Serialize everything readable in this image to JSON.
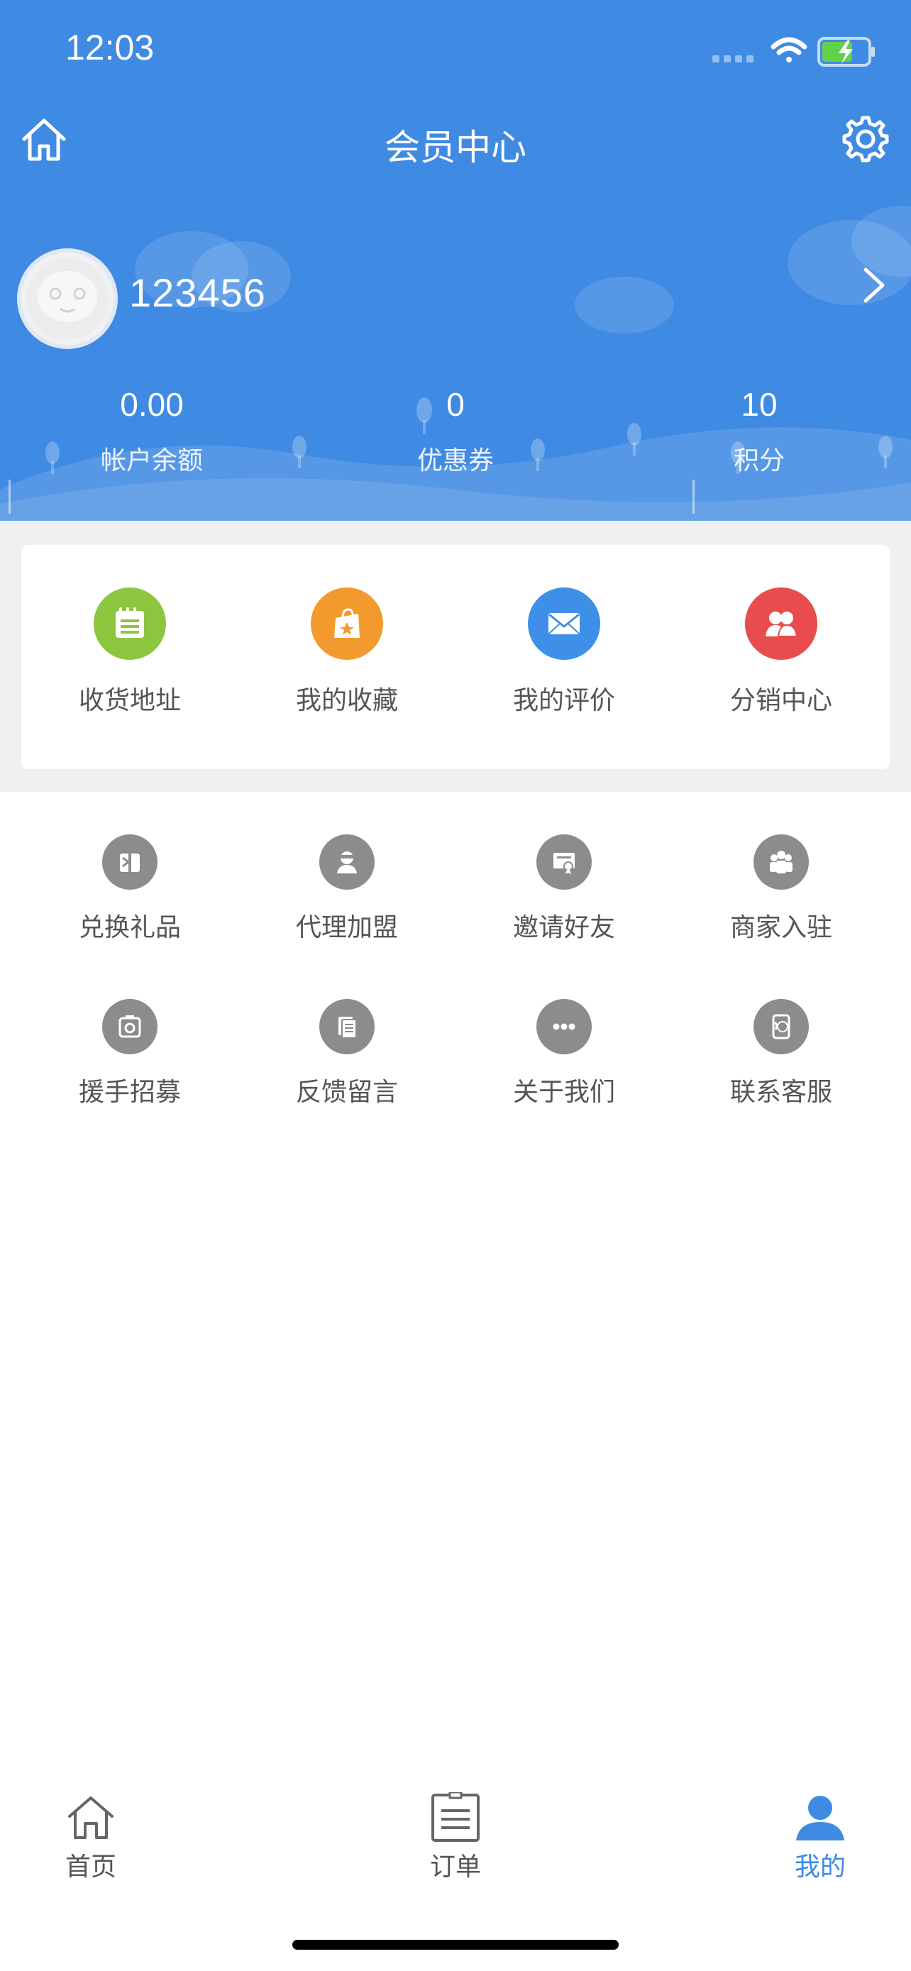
{
  "status_bar": {
    "time": "12:03",
    "icons": [
      "signal-icon",
      "wifi-icon",
      "battery-charging-icon"
    ]
  },
  "nav": {
    "title": "会员中心",
    "home_icon": "home-icon",
    "settings_icon": "gear-icon"
  },
  "profile": {
    "username": "123456",
    "avatar_icon": "avatar-face-icon",
    "chevron_icon": "chevron-right-icon"
  },
  "stats": [
    {
      "value": "0.00",
      "label": "帐户余额"
    },
    {
      "value": "0",
      "label": "优惠券"
    },
    {
      "value": "10",
      "label": "积分"
    }
  ],
  "quick_actions": [
    {
      "label": "收货地址",
      "icon": "address-book-icon",
      "color": "#8cc63f"
    },
    {
      "label": "我的收藏",
      "icon": "shopping-bag-star-icon",
      "color": "#f29a2e"
    },
    {
      "label": "我的评价",
      "icon": "envelope-icon",
      "color": "#3e8fe8"
    },
    {
      "label": "分销中心",
      "icon": "users-icon",
      "color": "#e84c4c"
    }
  ],
  "grid": [
    [
      {
        "label": "兑换礼品",
        "icon": "gift-icon"
      },
      {
        "label": "代理加盟",
        "icon": "agent-icon"
      },
      {
        "label": "邀请好友",
        "icon": "invite-icon"
      },
      {
        "label": "商家入驻",
        "icon": "merchant-icon"
      }
    ],
    [
      {
        "label": "援手招募",
        "icon": "camera-icon"
      },
      {
        "label": "反馈留言",
        "icon": "document-icon"
      },
      {
        "label": "关于我们",
        "icon": "ellipsis-icon"
      },
      {
        "label": "联系客服",
        "icon": "phone-service-icon"
      }
    ]
  ],
  "tabbar": [
    {
      "label": "首页",
      "icon": "home-outline-icon",
      "active": false
    },
    {
      "label": "订单",
      "icon": "order-list-icon",
      "active": false
    },
    {
      "label": "我的",
      "icon": "person-icon",
      "active": true
    }
  ],
  "colors": {
    "primary": "#3f8ae2",
    "icon_gray": "#8c8c8c",
    "background_gray": "#f0f0f0"
  }
}
